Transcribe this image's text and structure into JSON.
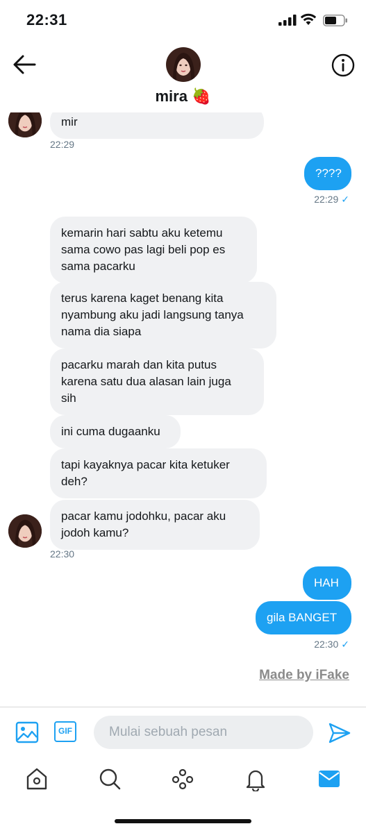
{
  "status_bar": {
    "time": "22:31"
  },
  "header": {
    "name": "mira 🍓"
  },
  "messages": [
    {
      "text": "mir",
      "side": "in"
    },
    {
      "timestamp": "22:29"
    },
    {
      "text": "????",
      "side": "out"
    },
    {
      "timestamp": "22:29",
      "read": "✓"
    },
    {
      "text": "kemarin hari sabtu aku ketemu\nsama cowo pas lagi beli pop es\nsama pacarku",
      "side": "in"
    },
    {
      "text": "terus karena kaget benang kita\nnyambung aku jadi langsung tanya\nnama dia siapa",
      "side": "in"
    },
    {
      "text": "pacarku marah dan kita putus\nkarena satu dua alasan lain juga\nsih",
      "side": "in"
    },
    {
      "text": "ini cuma dugaanku",
      "side": "in"
    },
    {
      "text": "tapi kayaknya pacar kita ketuker\ndeh?",
      "side": "in"
    },
    {
      "text": "pacar kamu jodohku, pacar aku\njodoh kamu?",
      "side": "in"
    },
    {
      "timestamp": "22:30"
    },
    {
      "text": "HAH",
      "side": "out"
    },
    {
      "text": "gila BANGET",
      "side": "out"
    },
    {
      "timestamp": "22:30",
      "read": "✓"
    }
  ],
  "watermark": "Made by iFake",
  "composer": {
    "placeholder": "Mulai sebuah pesan",
    "gif_label": "GIF"
  },
  "icons": {
    "back": "arrow-left-icon",
    "info": "info-icon",
    "image": "image-icon",
    "gif": "gif-icon",
    "send": "send-icon",
    "home": "home-icon",
    "search": "search-icon",
    "spaces": "spaces-icon",
    "notifications": "bell-icon",
    "messages": "mail-icon"
  },
  "colors": {
    "accent": "#1da1f2",
    "incoming_bubble": "#f0f1f3",
    "text": "#14171a",
    "muted": "#657786"
  }
}
